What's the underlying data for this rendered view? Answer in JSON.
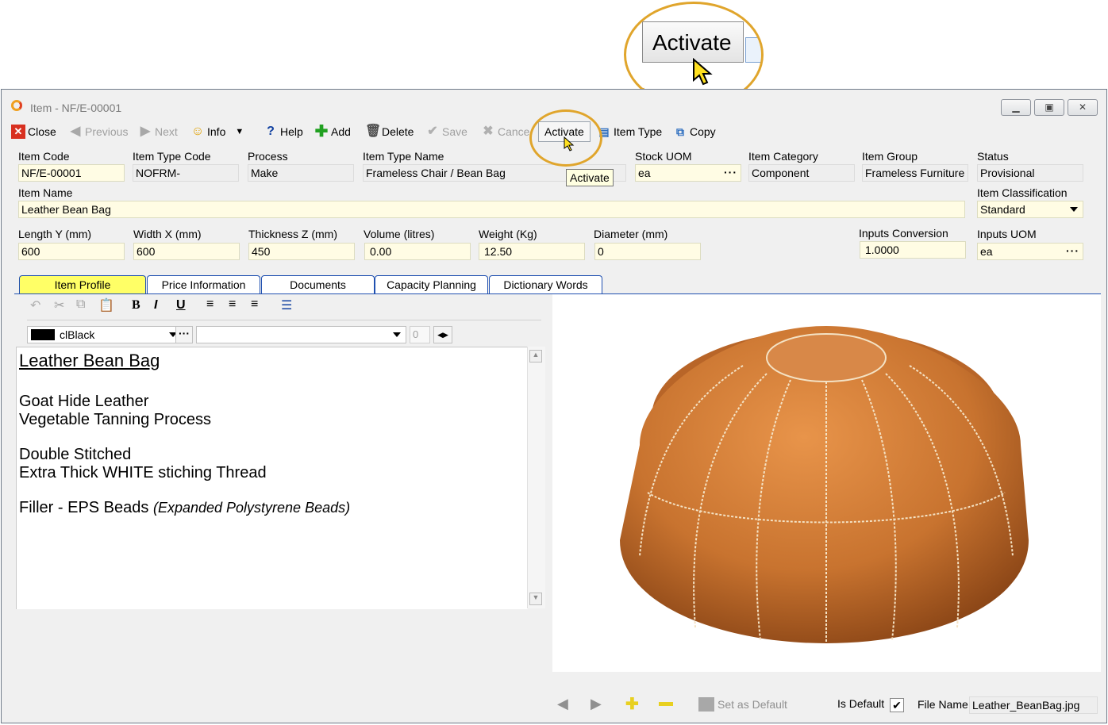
{
  "window": {
    "title": "Item - NF/E-00001"
  },
  "toolbar": {
    "close": "Close",
    "previous": "Previous",
    "next": "Next",
    "info": "Info",
    "help": "Help",
    "add": "Add",
    "delete": "Delete",
    "save": "Save",
    "cancel": "Cance",
    "activate": "Activate",
    "item_type": "Item Type",
    "copy": "Copy"
  },
  "tooltip": "Activate",
  "callout": {
    "label": "Activate"
  },
  "fields": {
    "item_code": {
      "label": "Item Code",
      "value": "NF/E-00001"
    },
    "item_type_code": {
      "label": "Item Type Code",
      "value": "NOFRM-"
    },
    "process": {
      "label": "Process",
      "value": "Make"
    },
    "item_type_name": {
      "label": "Item Type Name",
      "value": "Frameless Chair / Bean Bag"
    },
    "stock_uom": {
      "label": "Stock UOM",
      "value": "ea"
    },
    "item_category": {
      "label": "Item Category",
      "value": "Component"
    },
    "item_group": {
      "label": "Item Group",
      "value": "Frameless Furniture"
    },
    "status": {
      "label": "Status",
      "value": "Provisional"
    },
    "item_name": {
      "label": "Item Name",
      "value": "Leather Bean Bag"
    },
    "item_classification": {
      "label": "Item Classification",
      "value": "Standard"
    },
    "length_y": {
      "label": "Length Y (mm)",
      "value": "600"
    },
    "width_x": {
      "label": "Width X (mm)",
      "value": "600"
    },
    "thickness_z": {
      "label": "Thickness Z (mm)",
      "value": "450"
    },
    "volume": {
      "label": "Volume (litres)",
      "value": "0.00"
    },
    "weight": {
      "label": "Weight (Kg)",
      "value": "12.50"
    },
    "diameter": {
      "label": "Diameter (mm)",
      "value": "0"
    },
    "inputs_conversion": {
      "label": "Inputs Conversion",
      "value": "1.0000"
    },
    "inputs_uom": {
      "label": "Inputs UOM",
      "value": "ea"
    }
  },
  "tabs": [
    "Item Profile",
    "Price Information",
    "Documents",
    "Capacity Planning",
    "Dictionary Words"
  ],
  "editor": {
    "color": "clBlack",
    "font_size": "0",
    "heading": "Leather Bean Bag",
    "line1": "Goat Hide Leather",
    "line2": "Vegetable Tanning Process",
    "line3": "Double Stitched",
    "line4": "Extra Thick WHITE stiching Thread",
    "line5": "Filler - EPS Beads",
    "line5_italic": "(Expanded Polystyrene Beads)"
  },
  "image_footer": {
    "set_default": "Set as Default",
    "is_default": "Is Default",
    "file_name_label": "File Name",
    "file_name": "Leather_BeanBag.jpg"
  },
  "colors": {
    "accent": "#e0a52c",
    "editable_field": "#fffce4",
    "tab_active": "#ffff66",
    "leather": "#c8732f"
  }
}
